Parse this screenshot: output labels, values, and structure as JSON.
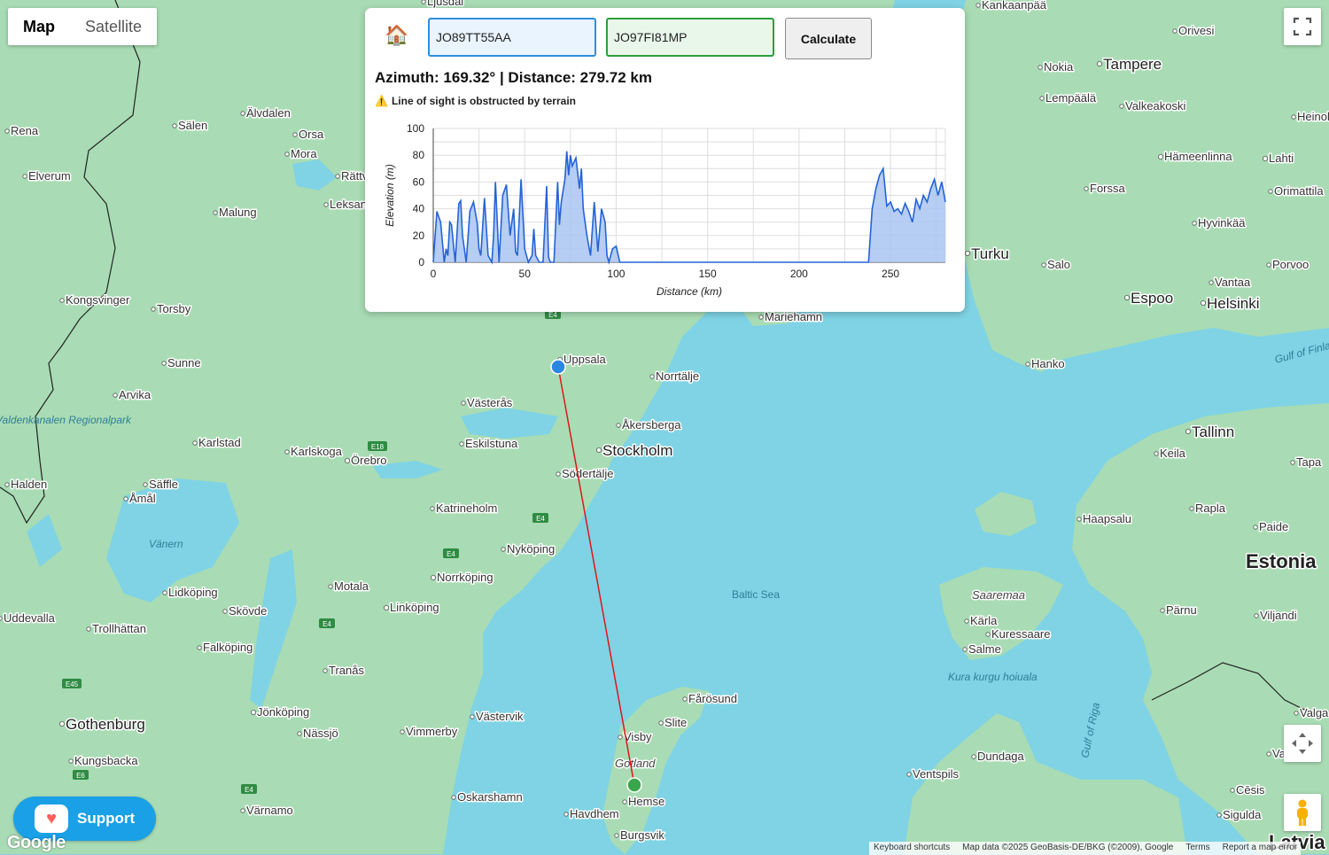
{
  "map_type": {
    "map_label": "Map",
    "satellite_label": "Satellite",
    "selected": "Map"
  },
  "calculator": {
    "home_icon": "🏠",
    "locator_a": "JO89TT55AA",
    "locator_b": "JO97FI81MP",
    "calculate_label": "Calculate",
    "result_text": "Azimuth: 169.32° | Distance: 279.72 km",
    "warning_icon": "⚠️",
    "warning_text": "Line of sight is obstructed by terrain",
    "azimuth_deg": 169.32,
    "distance_km": 279.72
  },
  "chart_data": {
    "type": "area",
    "title": "",
    "xlabel": "Distance (km)",
    "ylabel": "Elevation (m)",
    "xlim": [
      0,
      280
    ],
    "ylim": [
      0,
      100
    ],
    "xticks": [
      0,
      50,
      100,
      150,
      200,
      250
    ],
    "yticks": [
      0,
      20,
      40,
      60,
      80,
      100
    ],
    "grid": true,
    "color": "#2563d6",
    "fill": "#a9c4f2",
    "series": [
      {
        "x": [
          0,
          2,
          4,
          6,
          7,
          8,
          9,
          10,
          12,
          14,
          15,
          16,
          18,
          20,
          22,
          24,
          25,
          26,
          28,
          30,
          32,
          33,
          34,
          36,
          38,
          40,
          42,
          44,
          45,
          46,
          48,
          50,
          52,
          54,
          55,
          56,
          58,
          60,
          62,
          63,
          64,
          66,
          68,
          69,
          70,
          72,
          73,
          74,
          75,
          76,
          78,
          80,
          81,
          82,
          84,
          86,
          88,
          90,
          92,
          94,
          95,
          96,
          98,
          100,
          102,
          104,
          105,
          106,
          107,
          108,
          109,
          110,
          140,
          180,
          230,
          238,
          240,
          242,
          244,
          246,
          248,
          250,
          252,
          254,
          256,
          258,
          260,
          262,
          264,
          266,
          268,
          270,
          272,
          274,
          276,
          278,
          280
        ],
        "y": [
          0,
          38,
          30,
          0,
          10,
          5,
          30,
          28,
          0,
          44,
          46,
          20,
          0,
          38,
          45,
          30,
          10,
          5,
          48,
          5,
          0,
          20,
          60,
          0,
          50,
          58,
          20,
          40,
          8,
          5,
          62,
          10,
          0,
          5,
          25,
          5,
          0,
          0,
          57,
          4,
          0,
          0,
          60,
          28,
          45,
          62,
          83,
          65,
          80,
          72,
          78,
          55,
          70,
          40,
          20,
          5,
          45,
          8,
          40,
          30,
          5,
          0,
          10,
          12,
          0,
          0,
          0,
          0,
          0,
          0,
          0,
          0,
          0,
          0,
          0,
          0,
          40,
          55,
          65,
          70,
          42,
          45,
          38,
          40,
          36,
          44,
          38,
          30,
          47,
          40,
          50,
          45,
          55,
          62,
          50,
          60,
          45
        ]
      }
    ]
  },
  "map_labels": {
    "cities": [
      "Uppsala",
      "Norrtälje",
      "Västerås",
      "Åkersberga",
      "Stockholm",
      "Eskilstuna",
      "Södertälje",
      "Katrineholm",
      "Nyköping",
      "Norrköping",
      "Motala",
      "Linköping",
      "Örebro",
      "Karlskoga",
      "Karlstad",
      "Säffle",
      "Åmål",
      "Lidköping",
      "Skövde",
      "Trollhättan",
      "Uddevalla",
      "Falköping",
      "Tranås",
      "Jönköping",
      "Nässjö",
      "Vimmerby",
      "Västervik",
      "Gothenburg",
      "Kungsbacka",
      "Värnamo",
      "Oskarshamn",
      "Visby",
      "Slite",
      "Fårösund",
      "Hemse",
      "Havdhem",
      "Burgsvik",
      "Mariehamn",
      "Turku",
      "Salo",
      "Espoo",
      "Helsinki",
      "Vantaa",
      "Porvoo",
      "Hanko",
      "Tampere",
      "Nokia",
      "Orivesi",
      "Lempäälä",
      "Valkeakoski",
      "Hämeenlinna",
      "Lahti",
      "Forssa",
      "Orimattila",
      "Hyvinkää",
      "Tallinn",
      "Keila",
      "Tapa",
      "Haapsalu",
      "Rapla",
      "Paide",
      "Pärnu",
      "Viljandi",
      "Kärla",
      "Kuressaare",
      "Salme",
      "Ventspils",
      "Dundaga",
      "Valmiera",
      "Cēsis",
      "Sigulda",
      "Kongsvinger",
      "Torsby",
      "Sunne",
      "Arvika",
      "Halden",
      "Älvdalen",
      "Sälen",
      "Orsa",
      "Mora",
      "Malung",
      "Rättvik",
      "Leksand",
      "Rena",
      "Elverum",
      "Ljusdal",
      "Kankaanpää",
      "Heinola",
      "Valga"
    ],
    "regions": [
      "Estonia",
      "Latvia",
      "Saaremaa",
      "Gotland",
      "Kura kurgu hoiuala",
      "Valdenkanalen Regionalpark"
    ],
    "water": [
      "Baltic Sea",
      "Vänern",
      "Gulf of Riga",
      "Gulf of Finland"
    ],
    "roads": [
      "E4",
      "E18",
      "E45",
      "E6"
    ]
  },
  "markers": {
    "start_color": "#2a86e0",
    "end_color": "#3aa64a",
    "line_color": "#e0161a"
  },
  "support": {
    "label": "Support"
  },
  "google_logo": "Google",
  "attribution": {
    "shortcuts": "Keyboard shortcuts",
    "data": "Map data ©2025 GeoBasis-DE/BKG (©2009), Google",
    "terms": "Terms",
    "report": "Report a map error"
  }
}
